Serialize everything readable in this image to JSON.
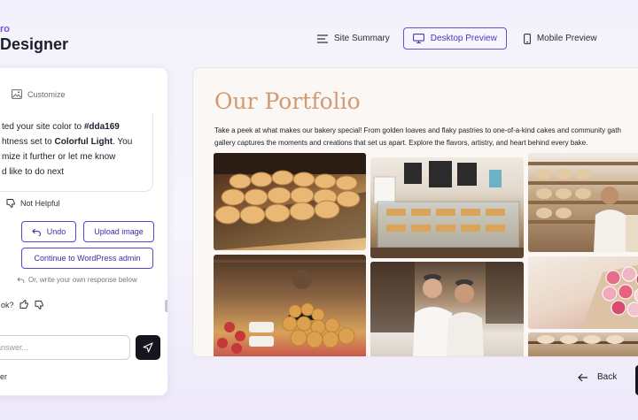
{
  "brand": {
    "subtitle": "ro",
    "title": "Designer"
  },
  "topnav": {
    "site_summary": "Site Summary",
    "desktop_preview": "Desktop Preview",
    "mobile_preview": "Mobile Preview"
  },
  "chat": {
    "tab_customize": "Customize",
    "message": {
      "line1_prefix": "ted your site color to ",
      "line1_color": "#dda169",
      "line2_prefix": "htness set to ",
      "line2_bold": "Colorful Light",
      "line2_suffix": ". You",
      "line3": "mize it further or let me know",
      "line4": "d like to do next"
    },
    "not_helpful": "Not Helpful",
    "undo": "Undo",
    "upload_image": "Upload image",
    "continue_wp": "Continue to WordPress admin",
    "write_own": "Or, write your own response below",
    "helpful_question": "ok?",
    "answer_placeholder": "answer...",
    "footer": "er"
  },
  "preview": {
    "title": "Our Portfolio",
    "body_line1": "Take a peek at what makes our bakery special! From golden loaves and flaky pastries to one-of-a-kind cakes and community gath",
    "body_line2": "gallery captures the moments and creations that set us apart. Explore the flavors, artistry, and heart behind every bake."
  },
  "footer_nav": {
    "back": "Back"
  },
  "colors": {
    "accent": "#5a45c9",
    "brand_purple": "#7b4fd6",
    "preview_title": "#d39a70",
    "send_button": "#16161f"
  }
}
